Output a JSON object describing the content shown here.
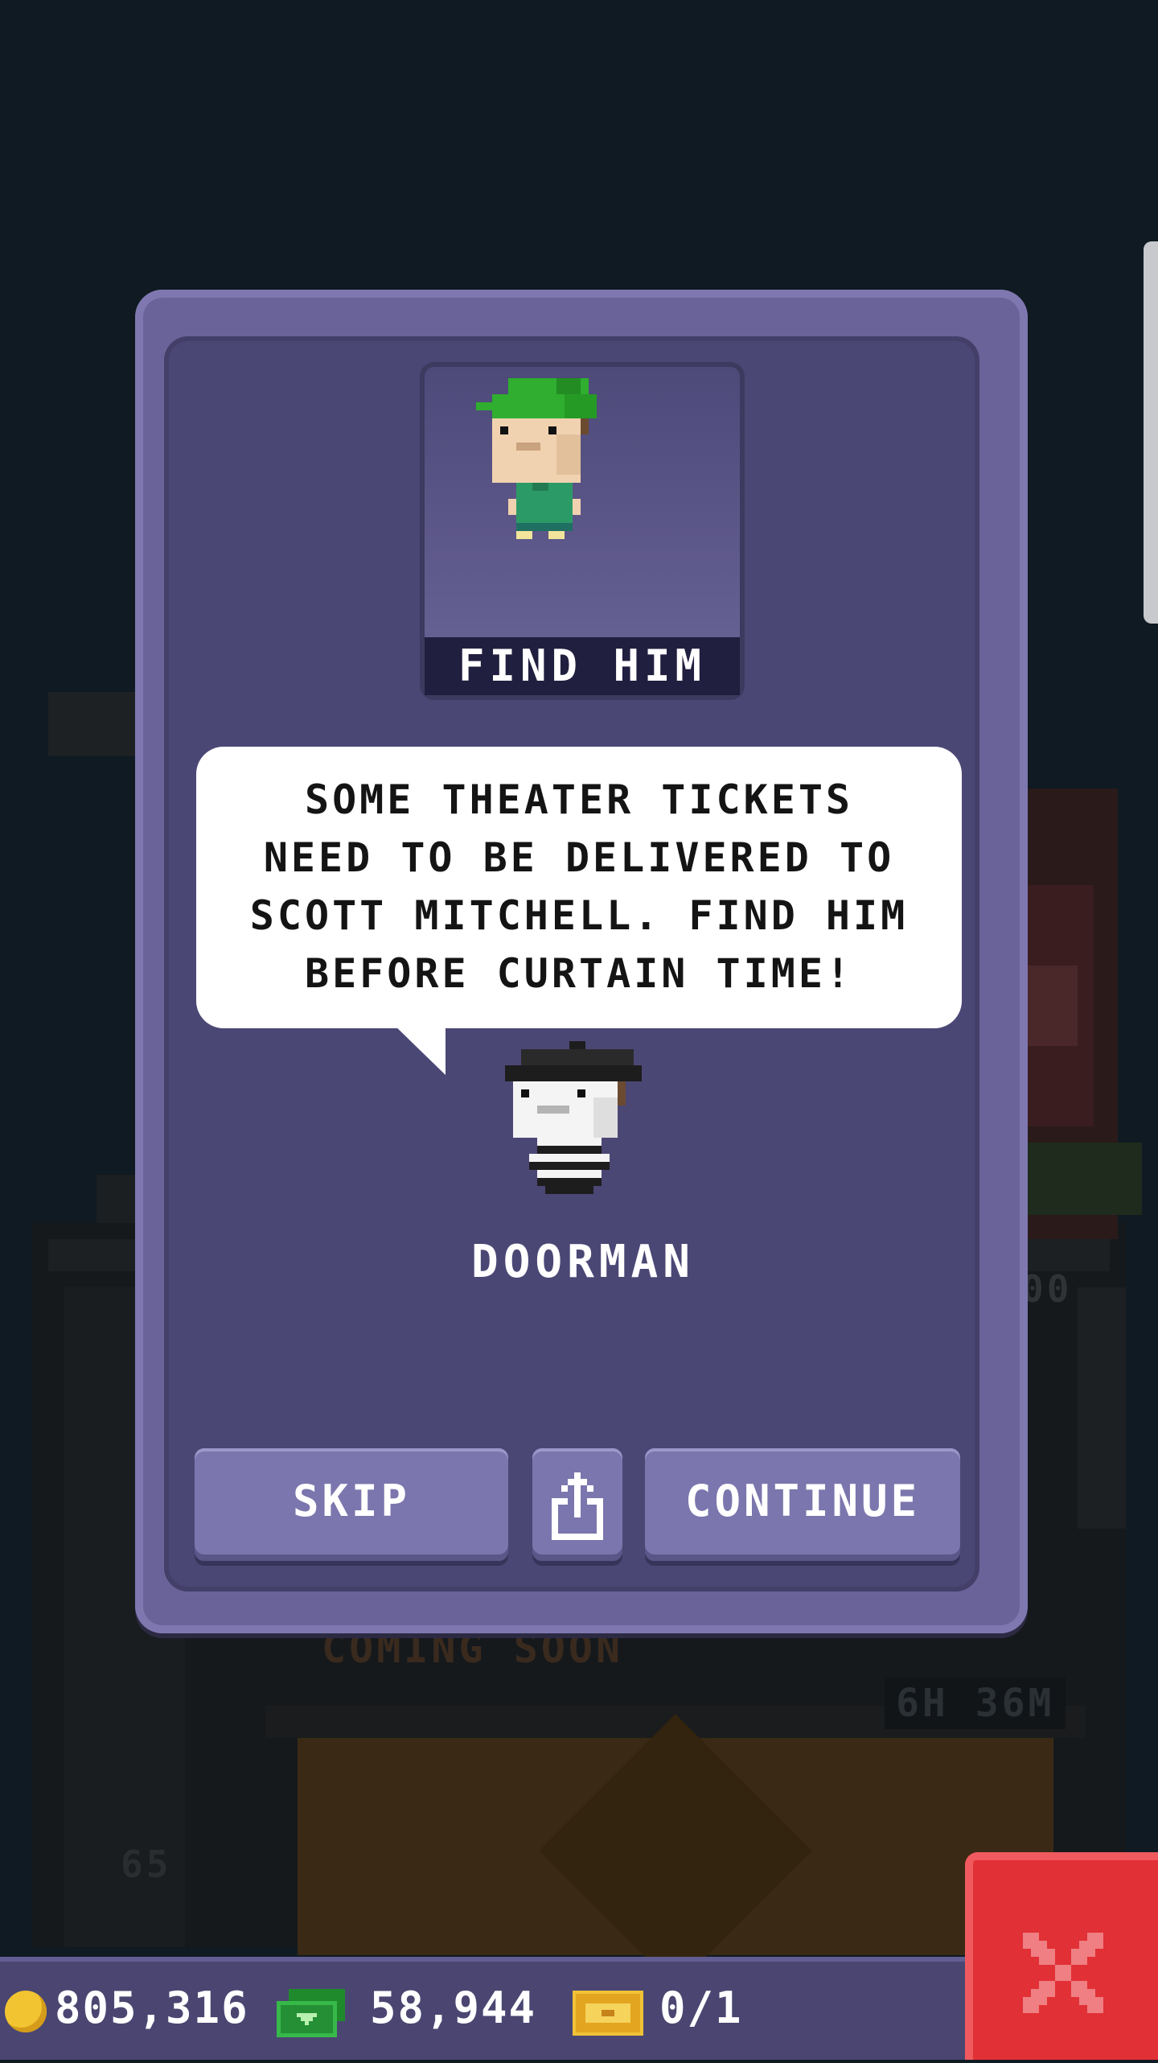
{
  "background": {
    "coming_soon": "COMING SOON",
    "timer": "6H 36M",
    "floor_number": "65",
    "elevator_count": "00"
  },
  "dialog": {
    "portrait_label": "FIND HIM",
    "message": "SOME THEATER TICKETS\nNEED TO BE DELIVERED TO\nSCOTT MITCHELL. FIND HIM\nBEFORE CURTAIN TIME!",
    "speaker": "DOORMAN",
    "buttons": {
      "skip": "SKIP",
      "continue": "CONTINUE",
      "share_icon": "share-icon"
    }
  },
  "status_bar": {
    "coins": "805,316",
    "bux": "58,944",
    "tickets": "0/1",
    "icons": [
      "coin-icon",
      "bux-icon",
      "ticket-icon"
    ]
  },
  "close_icon": "close-icon",
  "colors": {
    "dialog_frame": "#6a6399",
    "dialog_panel": "#4b4775",
    "button": "#7b76ad",
    "close_button": "#e13036",
    "status_bar": "#4a4671"
  }
}
